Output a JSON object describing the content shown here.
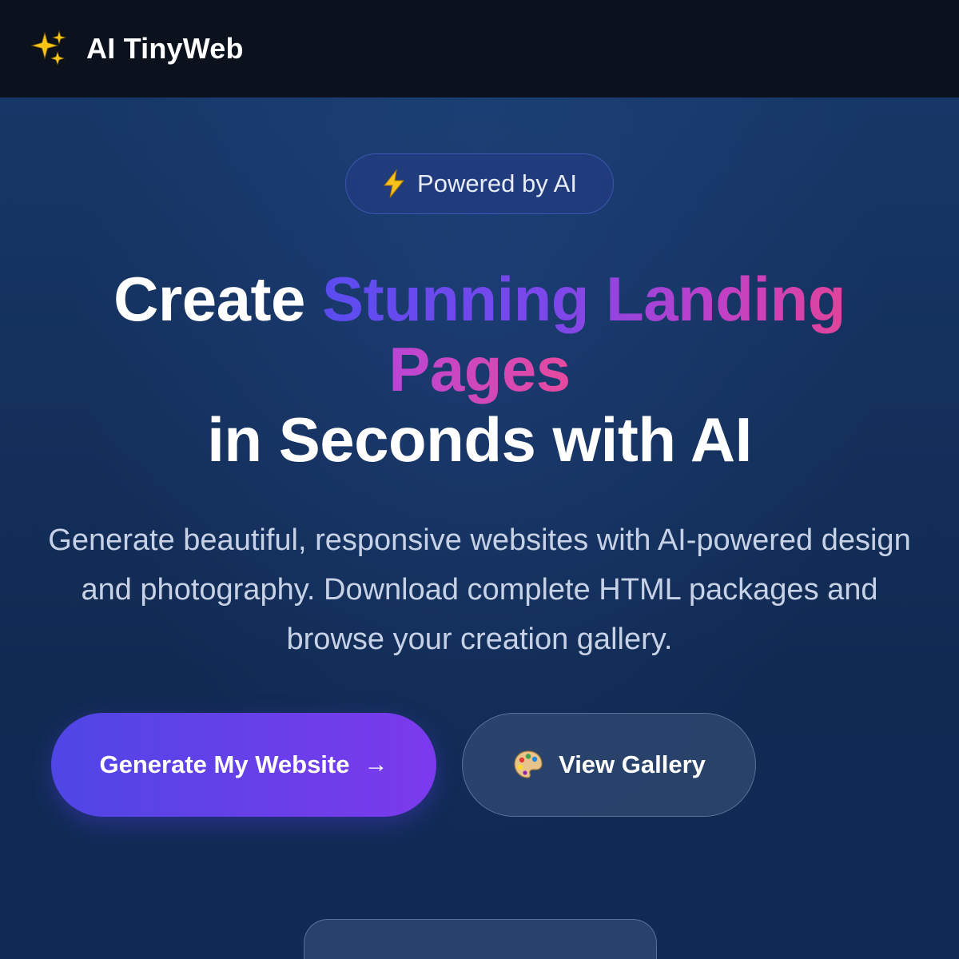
{
  "header": {
    "logo_icon": "sparkles-icon",
    "brand": "AI TinyWeb"
  },
  "badge": {
    "icon": "lightning-icon",
    "label": "Powered by AI"
  },
  "hero": {
    "title_part1": "Create ",
    "title_highlight1": "Stunning Landing",
    "title_highlight2": "Pages",
    "title_part2": "in Seconds with AI",
    "subtitle": "Generate beautiful, responsive websites with AI-powered design and photography. Download complete HTML packages and browse your creation gallery."
  },
  "actions": {
    "primary_label": "Generate My Website",
    "primary_arrow": "→",
    "secondary_icon": "palette-icon",
    "secondary_label": "View Gallery"
  },
  "colors": {
    "topbar": "#0c121d",
    "primary_gradient_start": "#4f46e5",
    "primary_gradient_end": "#7c3aed",
    "highlight_pink": "#e0449a"
  }
}
